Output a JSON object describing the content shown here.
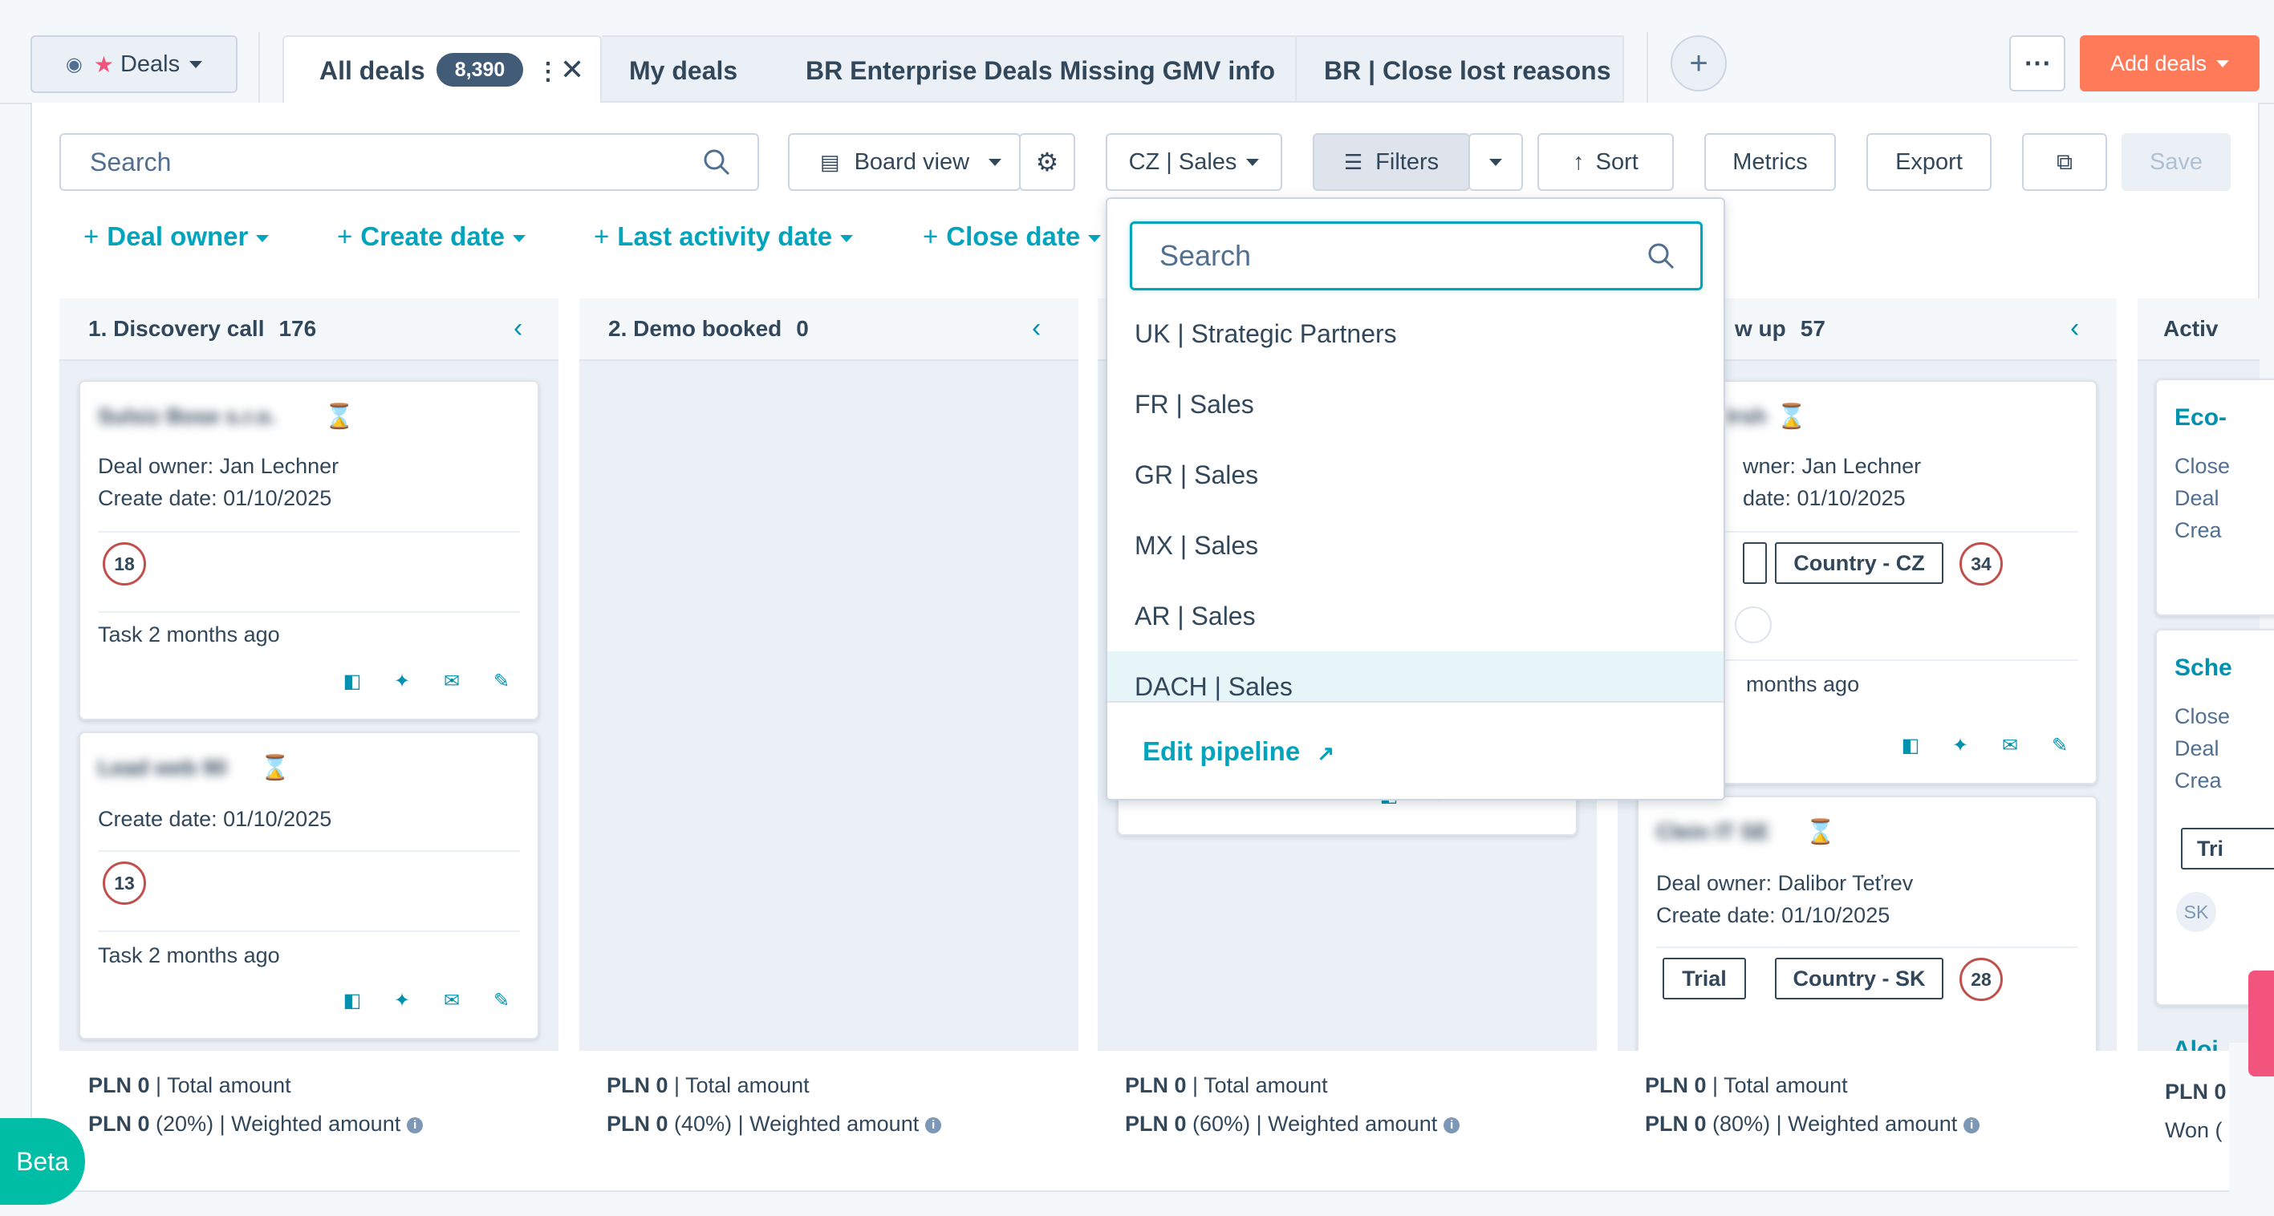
{
  "objectSwitcher": {
    "label": "Deals"
  },
  "tabs": [
    {
      "label": "All deals",
      "count": "8,390"
    },
    {
      "label": "My deals"
    },
    {
      "label": "BR Enterprise Deals Missing GMV info"
    },
    {
      "label": "BR | Close lost reasons"
    }
  ],
  "header": {
    "addDeals": "Add deals"
  },
  "toolbar": {
    "searchPlaceholder": "Search",
    "boardView": "Board view",
    "pipeline": "CZ | Sales",
    "filters": "Filters",
    "sort": "Sort",
    "metrics": "Metrics",
    "export": "Export",
    "save": "Save"
  },
  "quickFilters": [
    "Deal owner",
    "Create date",
    "Last activity date",
    "Close date"
  ],
  "columns": [
    {
      "title": "1. Discovery call",
      "count": "176",
      "total": "PLN 0",
      "totalLabel": "| Total amount",
      "weighted": "PLN 0",
      "weightedRest": "(20%) | Weighted amount"
    },
    {
      "title": "2. Demo booked",
      "count": "0",
      "total": "PLN 0",
      "totalLabel": "| Total amount",
      "weighted": "PLN 0",
      "weightedRest": "(40%) | Weighted amount"
    },
    {
      "title": "",
      "count": "",
      "total": "PLN 0",
      "totalLabel": "| Total amount",
      "weighted": "PLN 0",
      "weightedRest": "(60%) | Weighted amount"
    },
    {
      "title": "w up",
      "count": "57",
      "total": "PLN 0",
      "totalLabel": "| Total amount",
      "weighted": "PLN 0",
      "weightedRest": "(80%) | Weighted amount"
    },
    {
      "title": "Activ",
      "total": "PLN 0",
      "wonText": "Won ("
    }
  ],
  "cards": {
    "c1": {
      "name": "Sulsiz Bose s.r.o.",
      "owner": "Deal owner: Jan Lechner",
      "create": "Create date: 01/10/2025",
      "badge": "18",
      "task": "Task 2 months ago"
    },
    "c2": {
      "name": "Lead web 90",
      "create": "Create date: 01/10/2025",
      "badge": "13",
      "task": "Task 2 months ago"
    },
    "c3": {
      "name": "Irsh",
      "owner": "wner: Jan Lechner",
      "create": "date: 01/10/2025",
      "tag": "Country - CZ",
      "badge": "34",
      "task": "months ago"
    },
    "c4": {
      "name": "Clein IT SE",
      "owner": "Deal owner: Dalibor Teťrev",
      "create": "Create date: 01/10/2025",
      "tag1": "Trial",
      "tag2": "Country - SK",
      "badge": "28"
    },
    "c5": {
      "name": "Eco-",
      "line1": "Close",
      "line2": "Deal",
      "line3": "Crea"
    },
    "c6": {
      "name": "Sche",
      "line1": "Close",
      "line2": "Deal",
      "line3": "Crea",
      "tag": "Tri",
      "avatar": "SK"
    },
    "c7": {
      "name": "Aloi"
    }
  },
  "dropdown": {
    "searchPlaceholder": "Search",
    "items": [
      "UK | Strategic Partners",
      "FR | Sales",
      "GR | Sales",
      "MX | Sales",
      "AR | Sales",
      "DACH | Sales"
    ],
    "editPipeline": "Edit pipeline"
  },
  "beta": "Beta"
}
